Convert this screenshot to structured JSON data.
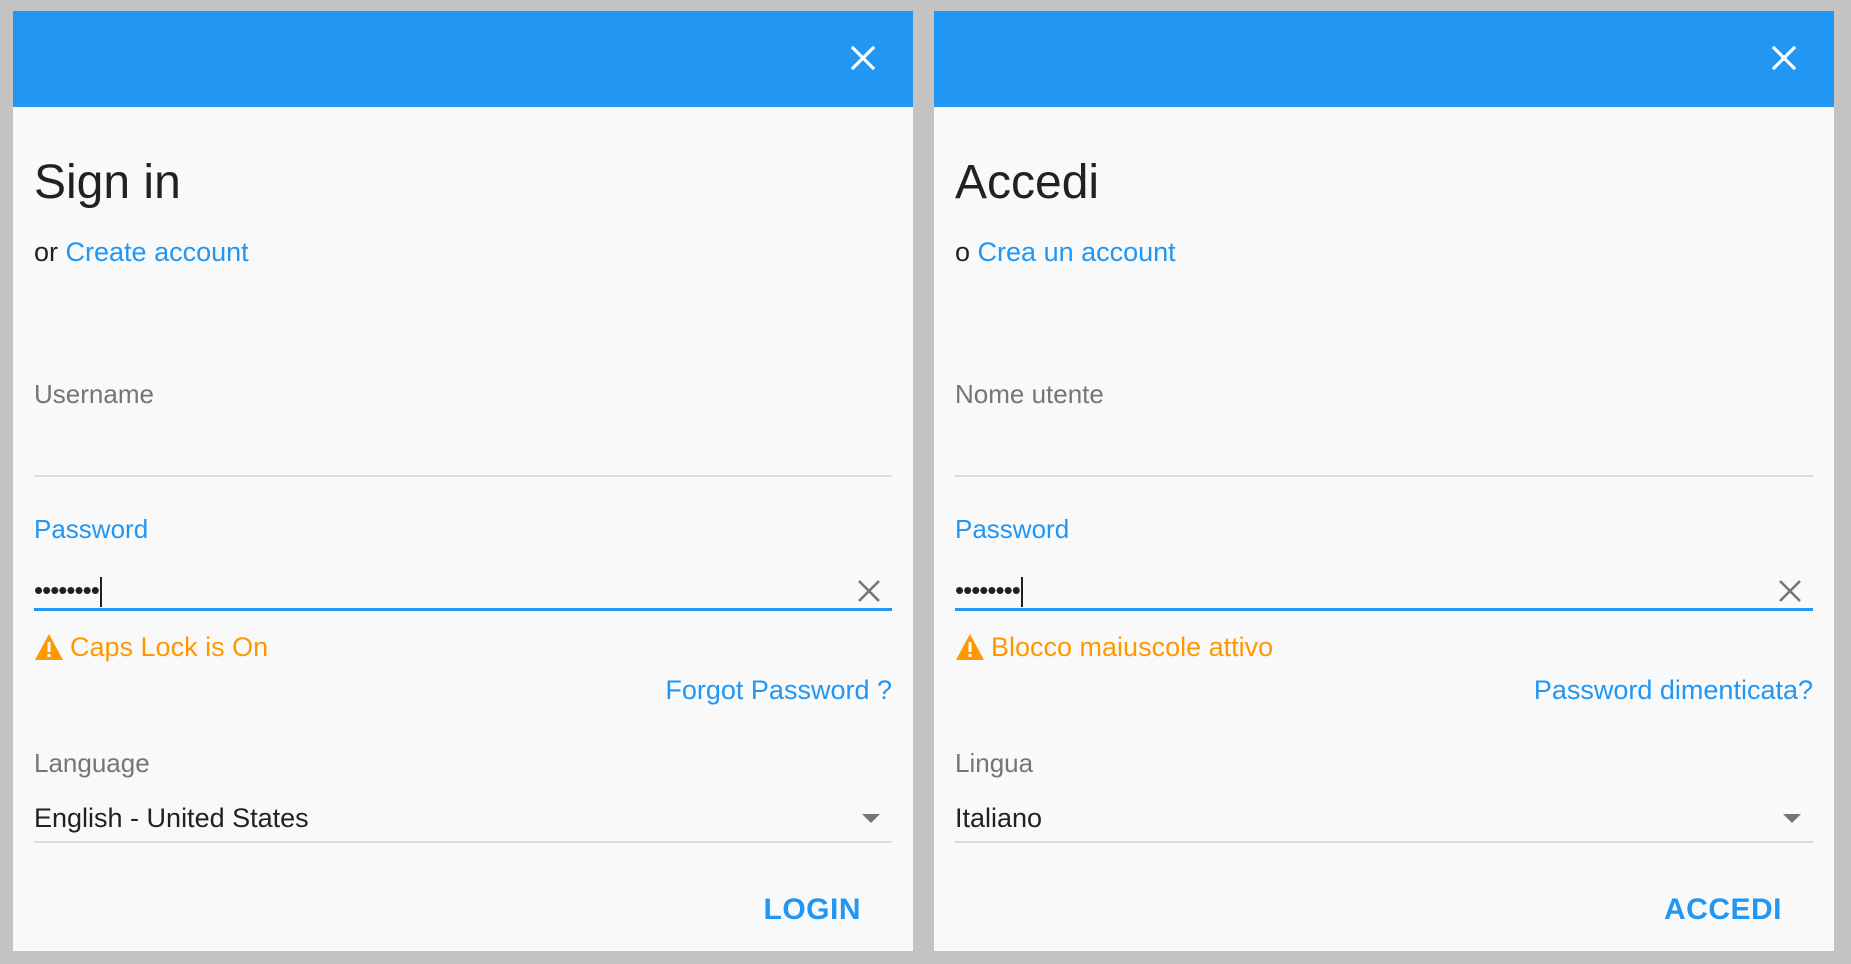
{
  "dialogs": [
    {
      "title": "Sign in",
      "subline_prefix": "or",
      "create_account_link": "Create account",
      "username_label": "Username",
      "username_value": "",
      "password_label": "Password",
      "password_masked": "••••••••",
      "caps_lock_warning": "Caps Lock is On",
      "forgot_password_link": "Forgot Password ?",
      "language_label": "Language",
      "language_value": "English - United States",
      "submit_label": "LOGIN"
    },
    {
      "title": "Accedi",
      "subline_prefix": "o",
      "create_account_link": "Crea un account",
      "username_label": "Nome utente",
      "username_value": "",
      "password_label": "Password",
      "password_masked": "••••••••",
      "caps_lock_warning": "Blocco maiuscole attivo",
      "forgot_password_link": "Password dimenticata?",
      "language_label": "Lingua",
      "language_value": "Italiano",
      "submit_label": "ACCEDI"
    }
  ],
  "colors": {
    "header": "#2196f3",
    "accent": "#2196f3",
    "warning": "#ff9800",
    "background": "#c3c3c3",
    "panel": "#f9f9f9"
  },
  "icons": {
    "close": "close-icon",
    "clear": "clear-icon",
    "warning": "warning-icon",
    "dropdown": "chevron-down-icon"
  }
}
